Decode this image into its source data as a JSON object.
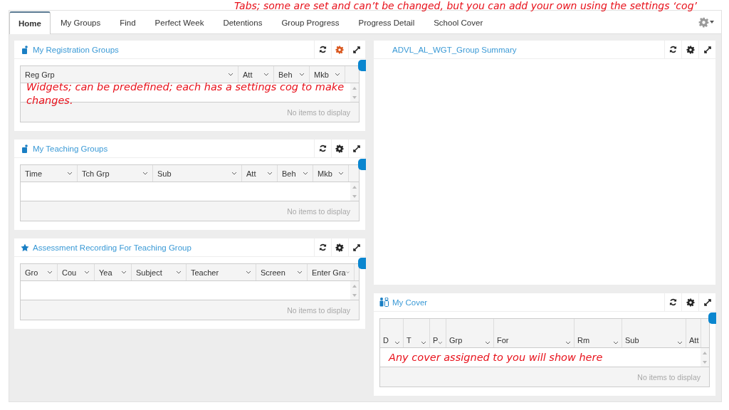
{
  "tabs": [
    {
      "label": "Home",
      "selected": true
    },
    {
      "label": "My Groups",
      "selected": false
    },
    {
      "label": "Find",
      "selected": false
    },
    {
      "label": "Perfect Week",
      "selected": false
    },
    {
      "label": "Detentions",
      "selected": false
    },
    {
      "label": "Group Progress",
      "selected": false
    },
    {
      "label": "Progress Detail",
      "selected": false
    },
    {
      "label": "School Cover",
      "selected": false
    }
  ],
  "columns_left": [
    {
      "title": "My Registration Groups",
      "settings_active": true,
      "kind": "grid",
      "grid": {
        "columns": [
          "Reg Grp",
          "Att",
          "Beh",
          "Mkb"
        ],
        "empty_text": "No items to display"
      }
    },
    {
      "title": "My Teaching Groups",
      "settings_active": false,
      "kind": "grid",
      "grid": {
        "columns": [
          "Time",
          "Tch Grp",
          "Sub",
          "Att",
          "Beh",
          "Mkb"
        ],
        "empty_text": "No items to display"
      }
    },
    {
      "title": "Assessment Recording For Teaching Group",
      "settings_active": false,
      "kind": "grid",
      "grid": {
        "columns": [
          "Gro",
          "Cou",
          "Yea",
          "Subject",
          "Teacher",
          "Screen",
          "Enter Gra"
        ],
        "empty_text": "No items to display"
      }
    }
  ],
  "columns_right": [
    {
      "title": "ADVL_AL_WGT_Group Summary",
      "settings_active": false,
      "kind": "blank"
    },
    {
      "title": "My Cover",
      "settings_active": false,
      "kind": "grid",
      "grid": {
        "columns": [
          "D",
          "T",
          "P",
          "Grp",
          "For",
          "Rm",
          "Sub",
          "Att"
        ],
        "empty_text": "No items to display"
      }
    }
  ],
  "annotations": [
    {
      "text": "Tabs; some are set and can’t be changed, but you can add your own using the settings ‘cog’"
    },
    {
      "text": "Widgets; can be predefined; each has a settings cog to make changes."
    },
    {
      "text": "Any cover assigned to you will show here"
    }
  ]
}
